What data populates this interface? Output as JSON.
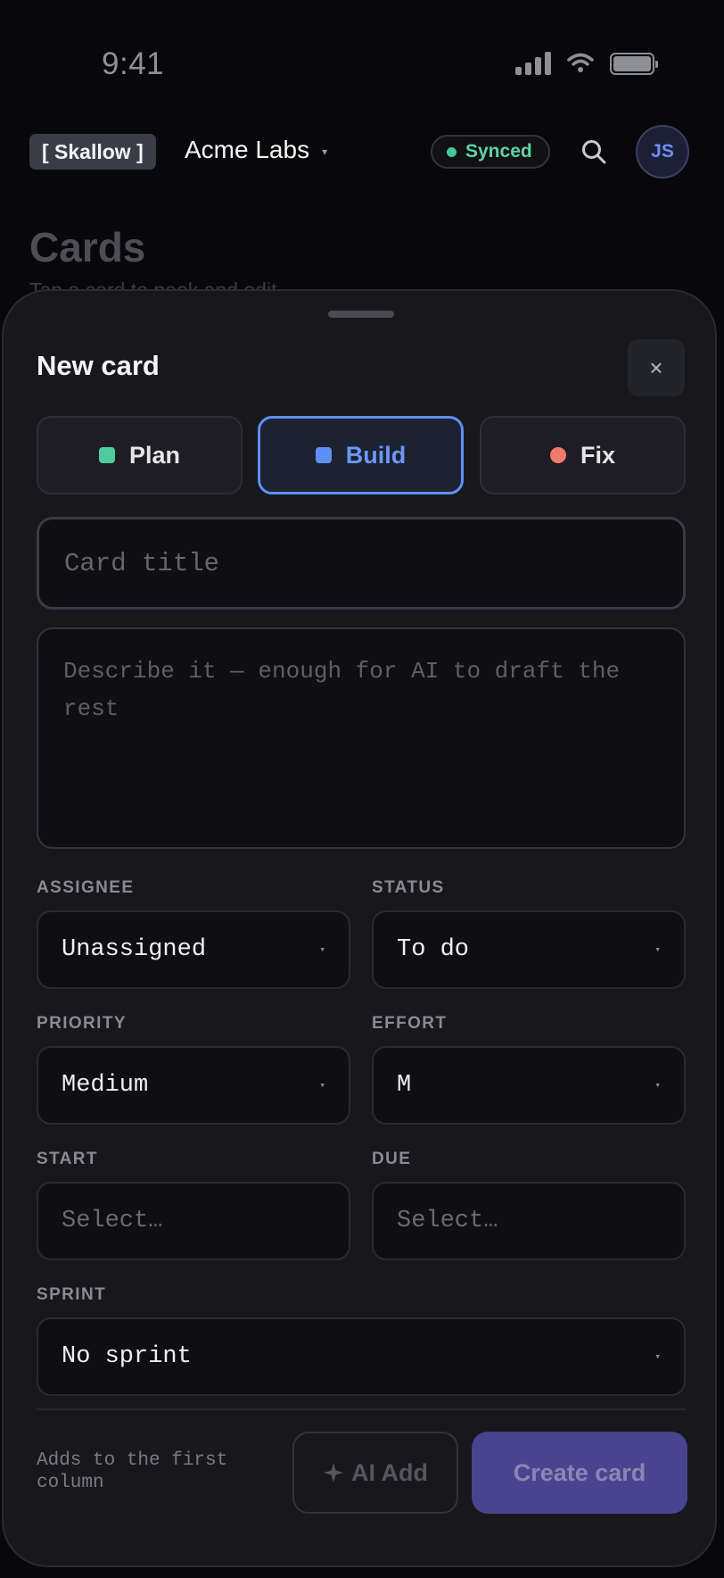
{
  "status_bar": {
    "time": "9:41",
    "signal_icon": "signal-icon",
    "wifi_icon": "wifi-icon",
    "battery_icon": "battery-icon"
  },
  "header": {
    "logo_text": "[ Skallow ]",
    "workspace_name": "Acme Labs",
    "sync_status": "Synced",
    "sync_color": "#43c997",
    "search_icon": "search-icon",
    "avatar_initials": "JS"
  },
  "page": {
    "title": "Cards",
    "subtitle": "Tap a card to peek and edit"
  },
  "sheet": {
    "title": "New card",
    "close_label": "×",
    "types": [
      {
        "label": "Plan",
        "color": "#4ecba0",
        "active": false
      },
      {
        "label": "Build",
        "color": "#5d8ff6",
        "active": true
      },
      {
        "label": "Fix",
        "color": "#f07a6a",
        "active": false
      }
    ],
    "title_placeholder": "Card title",
    "description_placeholder": "Describe it — enough for AI to draft the rest",
    "fields": {
      "assignee": {
        "label": "ASSIGNEE",
        "value": "Unassigned"
      },
      "status": {
        "label": "STATUS",
        "value": "To do"
      },
      "priority": {
        "label": "PRIORITY",
        "value": "Medium"
      },
      "effort": {
        "label": "EFFORT",
        "value": "M"
      },
      "start": {
        "label": "START",
        "value": "Select…"
      },
      "due": {
        "label": "DUE",
        "value": "Select…"
      },
      "sprint": {
        "label": "SPRINT",
        "value": "No sprint"
      }
    },
    "chevron": "▾",
    "footer_note": "Adds to the first column",
    "ai_add_label": "AI Add",
    "ai_add_icon": "sparkle-icon",
    "create_label": "Create card",
    "accent_color": "#4a438f"
  }
}
